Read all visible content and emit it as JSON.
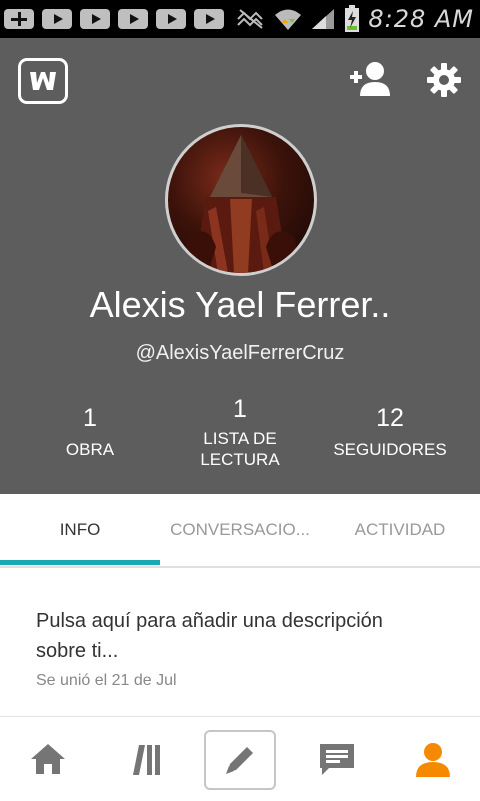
{
  "status_bar": {
    "time": "8:28 AM",
    "left_icons": [
      "add-icon",
      "youtube-icon",
      "youtube-icon",
      "youtube-icon",
      "youtube-icon",
      "youtube-icon"
    ],
    "right_icons": [
      "no-signal-icon",
      "wifi-icon",
      "cell-signal-icon",
      "battery-charging-icon"
    ]
  },
  "header": {
    "logo": "wattpad-logo",
    "actions": [
      "add-friend-icon",
      "settings-gear-icon"
    ]
  },
  "profile": {
    "name": "Alexis Yael Ferrer..",
    "handle": "@AlexisYaelFerrerCruz",
    "stats": [
      {
        "value": "1",
        "label": "OBRA"
      },
      {
        "value": "1",
        "label_line1": "LISTA DE",
        "label_line2": "LECTURA"
      },
      {
        "value": "12",
        "label": "SEGUIDORES"
      }
    ]
  },
  "tabs": {
    "items": [
      {
        "label": "INFO",
        "active": true
      },
      {
        "label": "CONVERSACIO..."
      },
      {
        "label": "ACTIVIDAD"
      }
    ],
    "accent_color": "#18a9b3"
  },
  "about": {
    "description_line1": "Pulsa aquí para añadir una descripción",
    "description_line2": "sobre ti...",
    "joined": "Se unió el 21 de Jul"
  },
  "bottom_nav": {
    "items": [
      "home-icon",
      "library-icon",
      "write-icon",
      "messages-icon",
      "profile-icon"
    ],
    "active": "profile-icon",
    "active_color": "#f58a00",
    "inactive_color": "#757575"
  }
}
